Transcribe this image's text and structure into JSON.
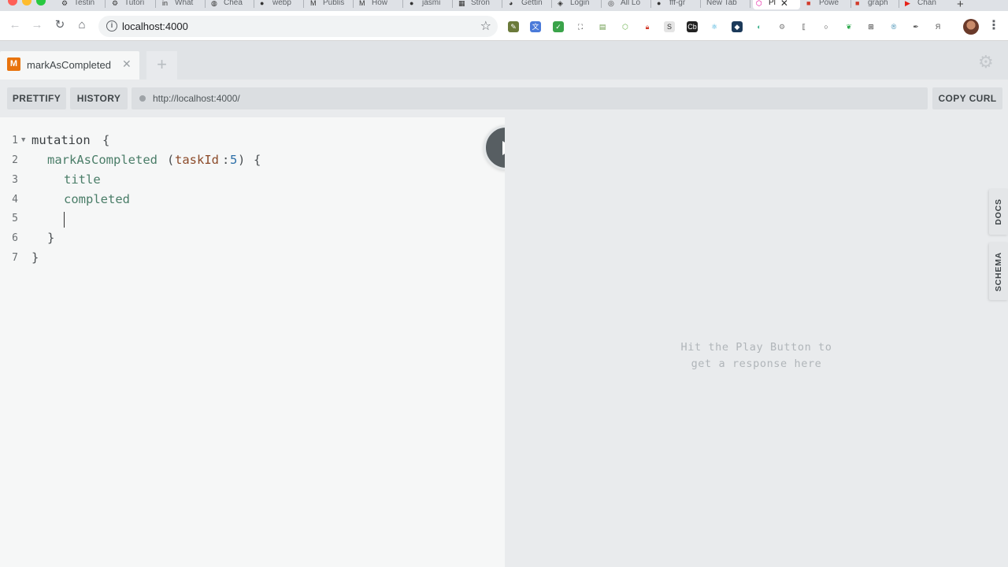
{
  "browser": {
    "tabs": [
      {
        "label": "Testin",
        "icon": "gear-icon"
      },
      {
        "label": "Tutori",
        "icon": "gear-icon"
      },
      {
        "label": "What",
        "icon": "linkedin-icon"
      },
      {
        "label": "Chea",
        "icon": "globe-icon"
      },
      {
        "label": "webp",
        "icon": "github-icon"
      },
      {
        "label": "Publis",
        "icon": "medium-icon"
      },
      {
        "label": "How",
        "icon": "medium-icon"
      },
      {
        "label": "jasmi",
        "icon": "github-icon"
      },
      {
        "label": "Stron",
        "icon": "grid-icon"
      },
      {
        "label": "Gettin",
        "icon": "owl-icon"
      },
      {
        "label": "Login",
        "icon": "codesandbox-icon"
      },
      {
        "label": "All Lo",
        "icon": "circle-icon"
      },
      {
        "label": "fff-gr",
        "icon": "github-icon"
      },
      {
        "label": "New Tab",
        "icon": ""
      },
      {
        "label": "Pl",
        "icon": "graphql-icon",
        "active": true
      },
      {
        "label": "Powe",
        "icon": "pdf-icon"
      },
      {
        "label": "graph",
        "icon": "pdf-icon"
      },
      {
        "label": "Chan",
        "icon": "youtube-icon"
      }
    ],
    "url": "localhost:4000"
  },
  "playground": {
    "tab": {
      "badge": "M",
      "title": "markAsCompleted"
    },
    "toolbar": {
      "prettify": "PRETTIFY",
      "history": "HISTORY",
      "endpoint": "http://localhost:4000/",
      "copy_curl": "COPY CURL"
    },
    "editor": {
      "line_numbers": [
        "1",
        "2",
        "3",
        "4",
        "5",
        "6",
        "7"
      ],
      "lines": {
        "l1_keyword": "mutation",
        "l1_brace": "{",
        "l2_field": "markAsCompleted",
        "l2_paren_open": "(",
        "l2_arg": "taskId",
        "l2_colon": ":",
        "l2_value": "5",
        "l2_paren_close": ")",
        "l2_brace": "{",
        "l3_field": "title",
        "l4_field": "completed",
        "l6_brace": "}",
        "l7_brace": "}"
      }
    },
    "result_placeholder": {
      "line1": "Hit the Play Button to",
      "line2": "get a response here"
    },
    "side_tabs": {
      "docs": "DOCS",
      "schema": "SCHEMA"
    }
  },
  "colors": {
    "badge": "#e8730d",
    "play_button": "#575e62",
    "argument": "#8c4b2a",
    "number": "#2d6fa8"
  }
}
